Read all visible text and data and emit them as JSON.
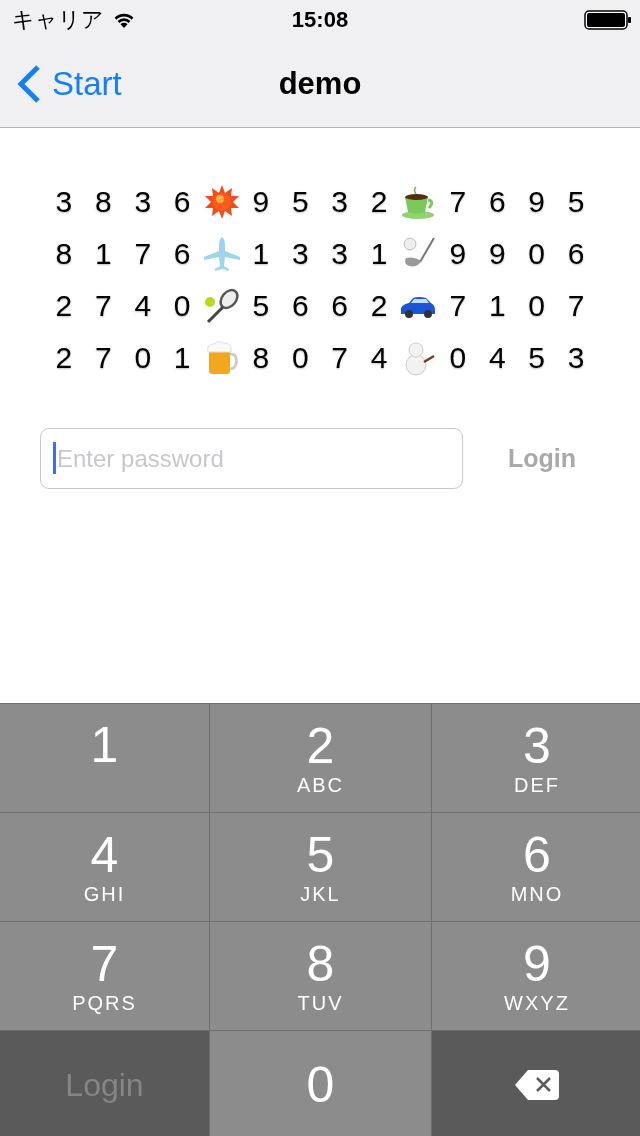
{
  "status_bar": {
    "carrier": "キャリア",
    "time": "15:08"
  },
  "nav": {
    "back": "Start",
    "title": "demo"
  },
  "grid": [
    [
      {
        "kind": "digit",
        "text": "3"
      },
      {
        "kind": "digit",
        "text": "8"
      },
      {
        "kind": "digit",
        "text": "3"
      },
      {
        "kind": "digit",
        "text": "6"
      },
      {
        "kind": "sun"
      },
      {
        "kind": "digit",
        "text": "9"
      },
      {
        "kind": "digit",
        "text": "5"
      },
      {
        "kind": "digit",
        "text": "3"
      },
      {
        "kind": "digit",
        "text": "2"
      },
      {
        "kind": "cup"
      },
      {
        "kind": "digit",
        "text": "7"
      },
      {
        "kind": "digit",
        "text": "6"
      },
      {
        "kind": "digit",
        "text": "9"
      },
      {
        "kind": "digit",
        "text": "5"
      }
    ],
    [
      {
        "kind": "digit",
        "text": "8"
      },
      {
        "kind": "digit",
        "text": "1"
      },
      {
        "kind": "digit",
        "text": "7"
      },
      {
        "kind": "digit",
        "text": "6"
      },
      {
        "kind": "plane"
      },
      {
        "kind": "digit",
        "text": "1"
      },
      {
        "kind": "digit",
        "text": "3"
      },
      {
        "kind": "digit",
        "text": "3"
      },
      {
        "kind": "digit",
        "text": "1"
      },
      {
        "kind": "golf"
      },
      {
        "kind": "digit",
        "text": "9"
      },
      {
        "kind": "digit",
        "text": "9"
      },
      {
        "kind": "digit",
        "text": "0"
      },
      {
        "kind": "digit",
        "text": "6"
      }
    ],
    [
      {
        "kind": "digit",
        "text": "2"
      },
      {
        "kind": "digit",
        "text": "7"
      },
      {
        "kind": "digit",
        "text": "4"
      },
      {
        "kind": "digit",
        "text": "0"
      },
      {
        "kind": "tennis"
      },
      {
        "kind": "digit",
        "text": "5"
      },
      {
        "kind": "digit",
        "text": "6"
      },
      {
        "kind": "digit",
        "text": "6"
      },
      {
        "kind": "digit",
        "text": "2"
      },
      {
        "kind": "car"
      },
      {
        "kind": "digit",
        "text": "7"
      },
      {
        "kind": "digit",
        "text": "1"
      },
      {
        "kind": "digit",
        "text": "0"
      },
      {
        "kind": "digit",
        "text": "7"
      }
    ],
    [
      {
        "kind": "digit",
        "text": "2"
      },
      {
        "kind": "digit",
        "text": "7"
      },
      {
        "kind": "digit",
        "text": "0"
      },
      {
        "kind": "digit",
        "text": "1"
      },
      {
        "kind": "beer"
      },
      {
        "kind": "digit",
        "text": "8"
      },
      {
        "kind": "digit",
        "text": "0"
      },
      {
        "kind": "digit",
        "text": "7"
      },
      {
        "kind": "digit",
        "text": "4"
      },
      {
        "kind": "snowman"
      },
      {
        "kind": "digit",
        "text": "0"
      },
      {
        "kind": "digit",
        "text": "4"
      },
      {
        "kind": "digit",
        "text": "5"
      },
      {
        "kind": "digit",
        "text": "3"
      }
    ]
  ],
  "password": {
    "placeholder": "Enter password"
  },
  "login_button": {
    "label": "Login",
    "disabled": true
  },
  "keypad": [
    {
      "kind": "digit",
      "digit": "1"
    },
    {
      "kind": "digit",
      "digit": "2",
      "letters": "ABC"
    },
    {
      "kind": "digit",
      "digit": "3",
      "letters": "DEF"
    },
    {
      "kind": "digit",
      "digit": "4",
      "letters": "GHI"
    },
    {
      "kind": "digit",
      "digit": "5",
      "letters": "JKL"
    },
    {
      "kind": "digit",
      "digit": "6",
      "letters": "MNO"
    },
    {
      "kind": "digit",
      "digit": "7",
      "letters": "PQRS"
    },
    {
      "kind": "digit",
      "digit": "8",
      "letters": "TUV"
    },
    {
      "kind": "digit",
      "digit": "9",
      "letters": "WXYZ"
    },
    {
      "kind": "action",
      "label": "Login",
      "disabled": true
    },
    {
      "kind": "digit",
      "digit": "0"
    },
    {
      "kind": "delete"
    }
  ]
}
